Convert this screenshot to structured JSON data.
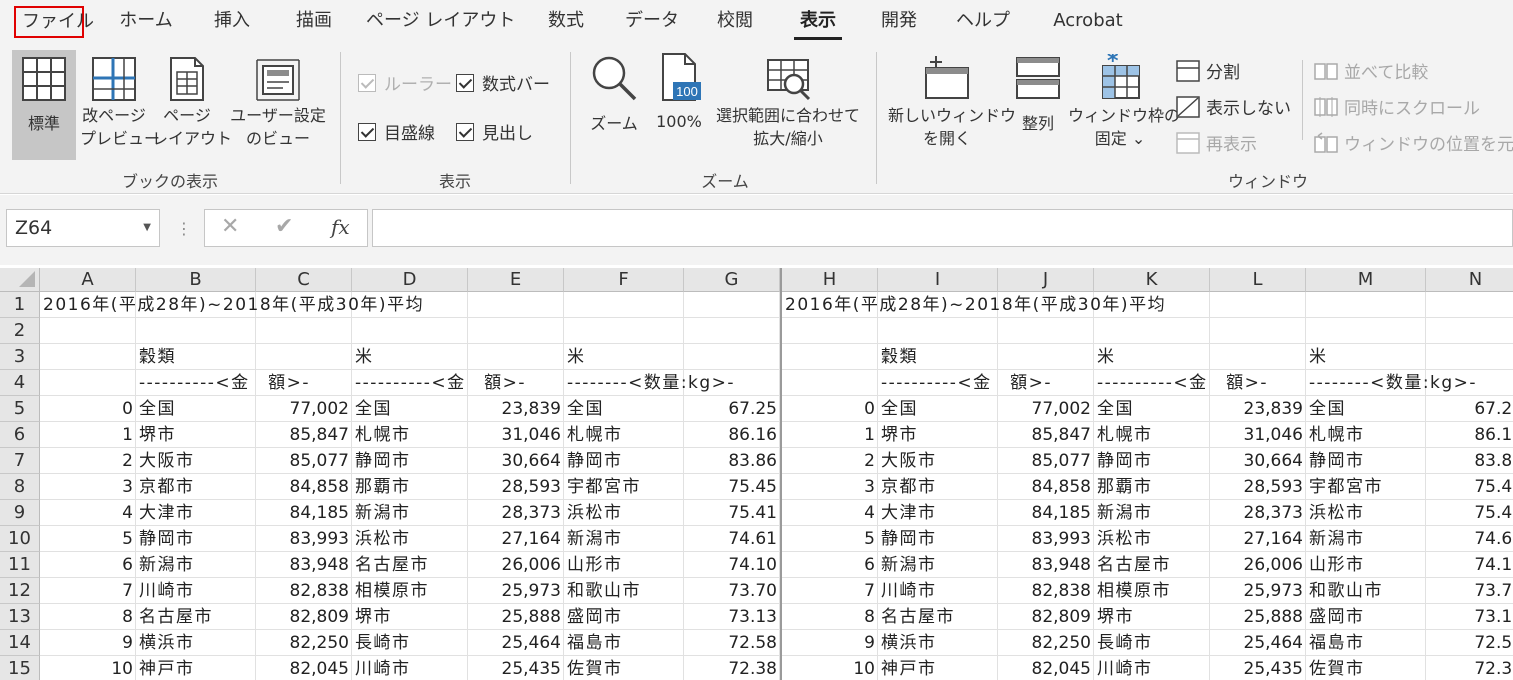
{
  "tabs": [
    "ファイル",
    "ホーム",
    "挿入",
    "描画",
    "ページ レイアウト",
    "数式",
    "データ",
    "校閲",
    "表示",
    "開発",
    "ヘルプ",
    "Acrobat"
  ],
  "active_tab": "表示",
  "ribbon": {
    "workbook_views": {
      "normal": "標準",
      "page_break_1": "改ページ",
      "page_break_2": "プレビュー",
      "page_layout_1": "ページ",
      "page_layout_2": "レイアウト",
      "custom_1": "ユーザー設定",
      "custom_2": "のビュー",
      "group": "ブックの表示"
    },
    "show": {
      "ruler": "ルーラー",
      "formula_bar": "数式バー",
      "gridlines": "目盛線",
      "headings": "見出し",
      "group": "表示"
    },
    "zoom": {
      "zoom": "ズーム",
      "zoom100": "100%",
      "zoom100_badge": "100",
      "zoom_sel_1": "選択範囲に合わせて",
      "zoom_sel_2": "拡大/縮小",
      "group": "ズーム"
    },
    "window": {
      "new_window_1": "新しいウィンドウ",
      "new_window_2": "を開く",
      "arrange": "整列",
      "freeze_1": "ウィンドウ枠の",
      "freeze_2": "固定 ⌄",
      "split": "分割",
      "hide": "表示しない",
      "unhide": "再表示",
      "side_by_side": "並べて比較",
      "sync_scroll": "同時にスクロール",
      "reset_position": "ウィンドウの位置を元に戻す",
      "group": "ウィンドウ"
    }
  },
  "formula_bar": {
    "name_box": "Z64",
    "cancel": "✕",
    "enter": "✔",
    "fx": "fx",
    "value": ""
  },
  "columns": [
    "A",
    "B",
    "C",
    "D",
    "E",
    "F",
    "G",
    "H",
    "I",
    "J",
    "K",
    "L",
    "M",
    "N"
  ],
  "rows": [
    "1",
    "2",
    "3",
    "4",
    "5",
    "6",
    "7",
    "8",
    "9",
    "10",
    "11",
    "12",
    "13",
    "14",
    "15"
  ],
  "sheet": {
    "title": "2016年(平成28年)~2018年(平成30年)平均",
    "hdr_cereal": "穀類",
    "hdr_rice": "米",
    "sub_amount": "----------<金　額>-",
    "sub_qty": "--------<数量:kg>-",
    "data": [
      [
        "0",
        "全国",
        "77,002",
        "全国",
        "23,839",
        "全国",
        "67.25"
      ],
      [
        "1",
        "堺市",
        "85,847",
        "札幌市",
        "31,046",
        "札幌市",
        "86.16"
      ],
      [
        "2",
        "大阪市",
        "85,077",
        "静岡市",
        "30,664",
        "静岡市",
        "83.86"
      ],
      [
        "3",
        "京都市",
        "84,858",
        "那覇市",
        "28,593",
        "宇都宮市",
        "75.45"
      ],
      [
        "4",
        "大津市",
        "84,185",
        "新潟市",
        "28,373",
        "浜松市",
        "75.41"
      ],
      [
        "5",
        "静岡市",
        "83,993",
        "浜松市",
        "27,164",
        "新潟市",
        "74.61"
      ],
      [
        "6",
        "新潟市",
        "83,948",
        "名古屋市",
        "26,006",
        "山形市",
        "74.10"
      ],
      [
        "7",
        "川崎市",
        "82,838",
        "相模原市",
        "25,973",
        "和歌山市",
        "73.70"
      ],
      [
        "8",
        "名古屋市",
        "82,809",
        "堺市",
        "25,888",
        "盛岡市",
        "73.13"
      ],
      [
        "9",
        "横浜市",
        "82,250",
        "長崎市",
        "25,464",
        "福島市",
        "72.58"
      ],
      [
        "10",
        "神戸市",
        "82,045",
        "川崎市",
        "25,435",
        "佐賀市",
        "72.38"
      ]
    ]
  }
}
